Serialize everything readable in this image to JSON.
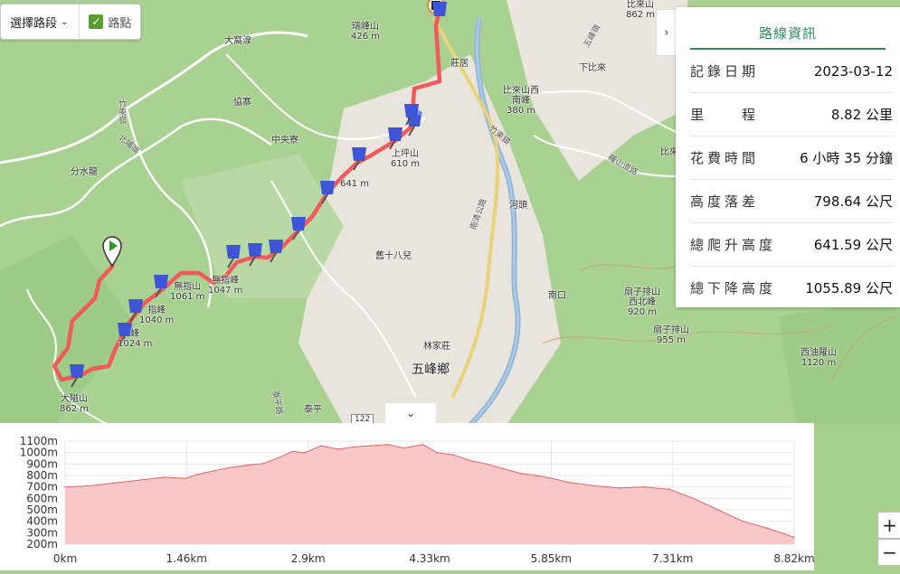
{
  "controls": {
    "segment_select": "選擇路段",
    "points_label": "路點"
  },
  "map_labels": {
    "reifeng": "瑞峰山",
    "reifeng_elev": "426 m",
    "dagaoliang": "大窩湶",
    "xiezhai": "協寨",
    "zhongyangliao": "中央寮",
    "fenshuilong": "分水龍",
    "zhudongling": "竹東嶺",
    "beidianling": "北埔嶺",
    "zhuangju": "莊居",
    "shangping_shan": "上坪山",
    "shangping_elev": "610 m",
    "p641": "641 m",
    "jiushibaer": "舊十八兒",
    "hetou": "河頭",
    "nankou": "南口",
    "linjiazhuang": "林家莊",
    "wufeng": "五峰鄉",
    "taiping": "泰平",
    "dalushan": "大隘山",
    "dalushan_elev": "862 m",
    "wuzhizhi_west": "無指山",
    "wuzhizhi_west_elev": "1061 m",
    "wuzhizhi": "無指峰",
    "wuzhizhi_elev": "1047 m",
    "p1040_name": "指峰",
    "p1040_elev": "1040 m",
    "p1024_name": "峰",
    "p1024_elev": "1024 m",
    "bilaishan": "比來山",
    "bilaishan_elev": "862 m",
    "bilai_west": "比來山西",
    "bilai_west2": "南峰",
    "bilai_west_elev": "380 m",
    "xiabilai": "下比來",
    "shangbilai": "比來",
    "shanzipai_west": "扇子排山",
    "shanzipai_west2": "西北峰",
    "shanzipai_west_elev": "920 m",
    "shanzipai": "扇子排山",
    "shanzipai_elev": "955 m",
    "xiyouluo": "西油羅山",
    "xiyouluo_elev": "1120 m",
    "road_122": "122",
    "road_wufeng": "五峰嶺",
    "road_zhudong": "竹東鎮",
    "road_luoshan": "羅山道路",
    "road_nanqing": "南清公路",
    "road_taiping": "泰平路"
  },
  "info_panel": {
    "title": "路線資訊",
    "rows": [
      {
        "label": "記錄日期",
        "value": "2023-03-12"
      },
      {
        "label": "里　　程",
        "value": "8.82 公里"
      },
      {
        "label": "花費時間",
        "value": "6 小時 35 分鐘"
      },
      {
        "label": "高度落差",
        "value": "798.64 公尺"
      },
      {
        "label": "總爬升高度",
        "value": "641.59 公尺"
      },
      {
        "label": "總下降高度",
        "value": "1055.89 公尺"
      }
    ]
  },
  "zoom": {
    "in": "+",
    "out": "−"
  },
  "icons": {
    "panel_collapse": "chevron-right-icon",
    "elev_toggle": "chevron-down-icon",
    "waypoint": "blue-pushpin-icon",
    "start": "green-flag-marker-icon",
    "end": "end-marker-icon"
  },
  "colors": {
    "route": "#f05a5a",
    "elevation_fill": "#f9c7c7",
    "elevation_line": "#e06666",
    "accent": "#2e8b57"
  },
  "chart_data": {
    "type": "area",
    "x_tick_labels": [
      "0km",
      "1.46km",
      "2.9km",
      "4.33km",
      "5.85km",
      "7.31km",
      "8.82km"
    ],
    "y_tick_labels": [
      "200m",
      "300m",
      "400m",
      "500m",
      "600m",
      "700m",
      "800m",
      "900m",
      "1000m",
      "1100m"
    ],
    "xlim": [
      0,
      8.82
    ],
    "ylim": [
      200,
      1100
    ],
    "grid": true,
    "x": [
      0,
      0.3,
      0.6,
      0.9,
      1.2,
      1.46,
      1.6,
      1.8,
      2.0,
      2.2,
      2.4,
      2.6,
      2.75,
      2.9,
      3.1,
      3.3,
      3.5,
      3.7,
      3.9,
      4.1,
      4.33,
      4.5,
      4.7,
      4.9,
      5.1,
      5.3,
      5.5,
      5.7,
      5.85,
      6.1,
      6.4,
      6.7,
      7.0,
      7.31,
      7.6,
      7.9,
      8.2,
      8.5,
      8.82
    ],
    "y": [
      700,
      710,
      735,
      760,
      785,
      775,
      810,
      840,
      870,
      890,
      905,
      960,
      1010,
      1000,
      1060,
      1030,
      1050,
      1060,
      1070,
      1040,
      1070,
      1000,
      980,
      930,
      900,
      860,
      820,
      800,
      780,
      740,
      710,
      690,
      700,
      680,
      600,
      500,
      400,
      340,
      260
    ]
  }
}
